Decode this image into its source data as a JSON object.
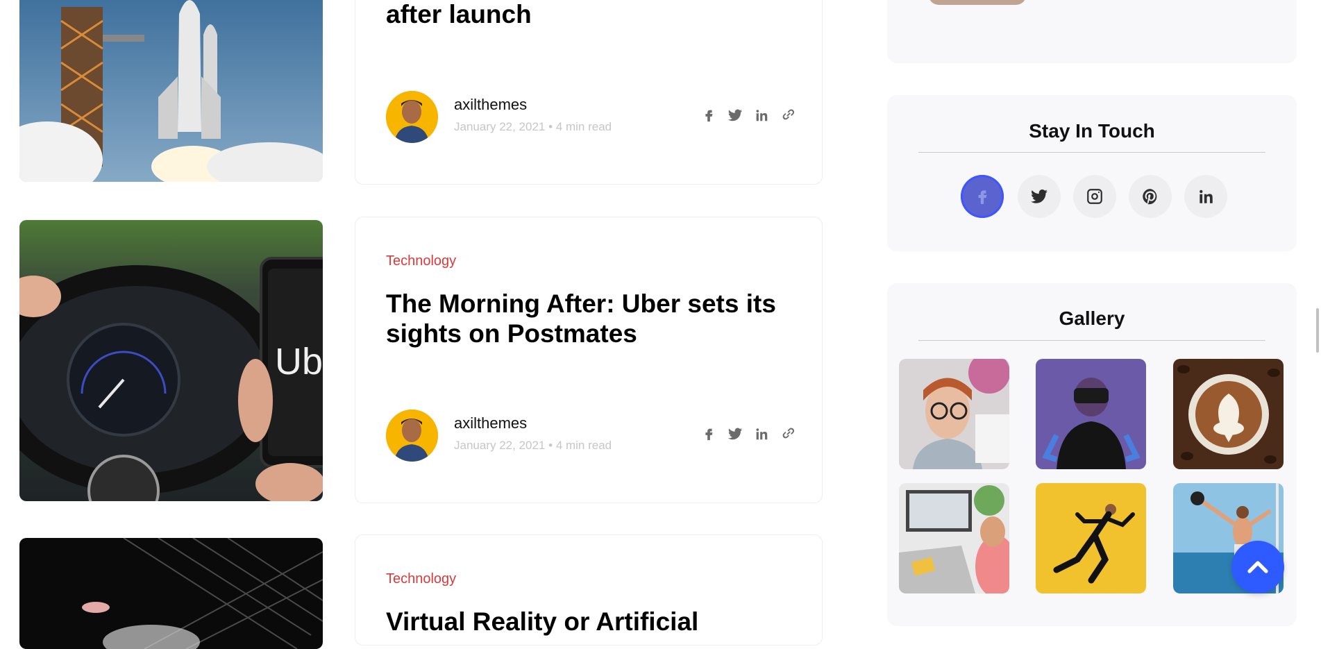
{
  "colors": {
    "category": "#d93a3a",
    "accent": "#2e5bff",
    "panel_bg": "#f8f8fb"
  },
  "posts": [
    {
      "category": "",
      "title": "after launch",
      "author": "axilthemes",
      "date": "January 22, 2021",
      "read_time": "4 min read",
      "separator": "•"
    },
    {
      "category": "Technology",
      "title": "The Morning After: Uber sets its sights on Postmates",
      "author": "axilthemes",
      "date": "January 22, 2021",
      "read_time": "4 min read",
      "separator": "•"
    },
    {
      "category": "Technology",
      "title": "Virtual Reality or Artificial"
    }
  ],
  "share_icons": [
    "facebook-icon",
    "twitter-icon",
    "linkedin-icon",
    "link-icon"
  ],
  "sidebar": {
    "stay_in_touch": {
      "title": "Stay In Touch",
      "networks": [
        "facebook",
        "twitter",
        "instagram",
        "pinterest",
        "linkedin"
      ]
    },
    "gallery": {
      "title": "Gallery",
      "images": [
        "woman-with-glasses",
        "vr-headset-man",
        "latte-art-coffee",
        "designer-desk",
        "runner-yellow",
        "man-on-boat"
      ]
    }
  },
  "scroll_top_icon": "chevron-up-icon"
}
